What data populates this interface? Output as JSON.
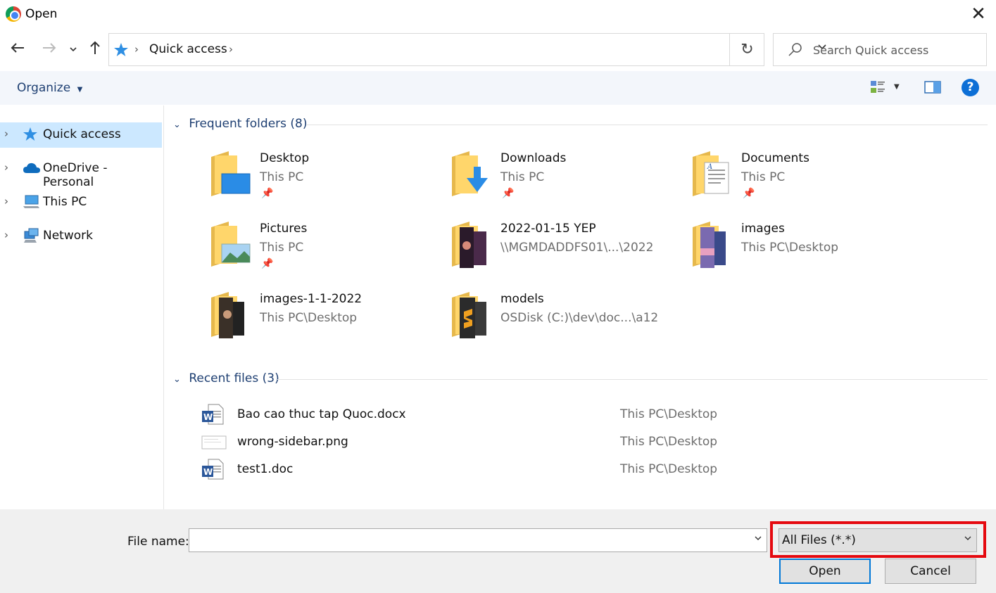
{
  "window": {
    "title": "Open",
    "close_icon": "close-icon"
  },
  "nav": {
    "back_icon": "back-arrow-icon",
    "forward_icon": "forward-arrow-icon",
    "recent_icon": "chevron-down-icon",
    "up_icon": "up-arrow-icon"
  },
  "address": {
    "segments": [
      "Quick access"
    ],
    "refresh_icon": "refresh-icon"
  },
  "search": {
    "placeholder": "Search Quick access"
  },
  "toolbar": {
    "organize_label": "Organize"
  },
  "sidebar": {
    "items": [
      {
        "label": "Quick access",
        "icon": "star-icon",
        "selected": true
      },
      {
        "label": "OneDrive - Personal",
        "icon": "cloud-icon",
        "selected": false
      },
      {
        "label": "This PC",
        "icon": "computer-icon",
        "selected": false
      },
      {
        "label": "Network",
        "icon": "network-icon",
        "selected": false
      }
    ]
  },
  "frequent": {
    "header": "Frequent folders (8)",
    "folders": [
      {
        "name": "Desktop",
        "path": "This PC",
        "pinned": true
      },
      {
        "name": "Downloads",
        "path": "This PC",
        "pinned": true
      },
      {
        "name": "Documents",
        "path": "This PC",
        "pinned": true
      },
      {
        "name": "Pictures",
        "path": "This PC",
        "pinned": true
      },
      {
        "name": "2022-01-15 YEP",
        "path": "\\\\MGMDADDFS01\\...\\2022",
        "pinned": false
      },
      {
        "name": "images",
        "path": "This PC\\Desktop",
        "pinned": false
      },
      {
        "name": "images-1-1-2022",
        "path": "This PC\\Desktop",
        "pinned": false
      },
      {
        "name": "models",
        "path": "OSDisk (C:)\\dev\\doc...\\a12",
        "pinned": false
      }
    ]
  },
  "recent": {
    "header": "Recent files (3)",
    "files": [
      {
        "name": "Bao cao thuc tap Quoc.docx",
        "path": "This PC\\Desktop",
        "icon": "word-document-icon"
      },
      {
        "name": "wrong-sidebar.png",
        "path": "This PC\\Desktop",
        "icon": "image-file-icon"
      },
      {
        "name": "test1.doc",
        "path": "This PC\\Desktop",
        "icon": "word-document-icon"
      }
    ]
  },
  "bottom": {
    "filename_label": "File name:",
    "filename_value": "",
    "filter_value": "All Files (*.*)",
    "open_label": "Open",
    "cancel_label": "Cancel"
  },
  "colors": {
    "accent": "#0078d7",
    "highlight_box": "#e5090f",
    "selection": "#cce8ff",
    "link": "#1e3f72"
  }
}
